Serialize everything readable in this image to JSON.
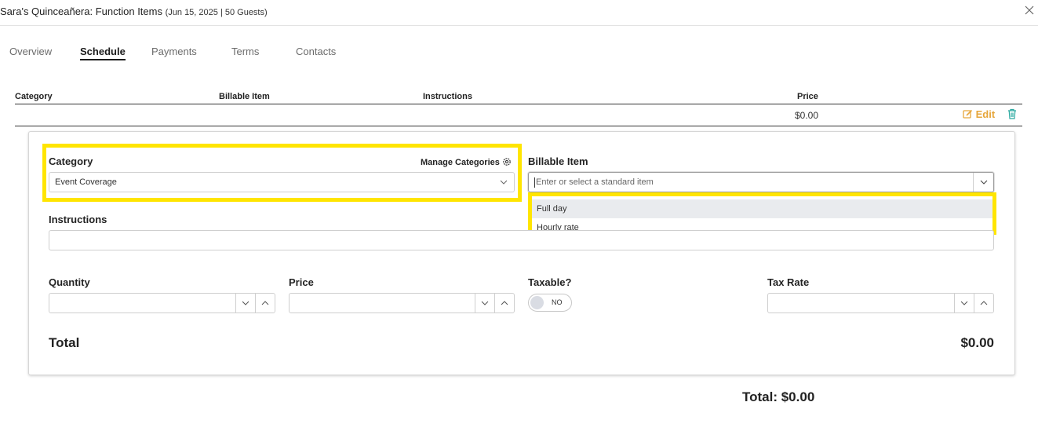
{
  "header": {
    "title": "Sara's Quinceañera: Function Items",
    "subtitle": "(Jun 15, 2025 | 50 Guests)"
  },
  "tabs": [
    {
      "label": "Overview",
      "active": false
    },
    {
      "label": "Schedule",
      "active": true
    },
    {
      "label": "Payments",
      "active": false
    },
    {
      "label": "Terms",
      "active": false
    },
    {
      "label": "Contacts",
      "active": false
    }
  ],
  "table": {
    "columns": [
      "Category",
      "Billable Item",
      "Instructions",
      "Price"
    ],
    "row": {
      "price": "$0.00",
      "edit_label": "Edit"
    }
  },
  "form": {
    "category_label": "Category",
    "manage_categories_label": "Manage Categories",
    "category_value": "Event Coverage",
    "billable_label": "Billable Item",
    "billable_placeholder": "Enter or select a standard item",
    "billable_options": [
      "Full day",
      "Hourly rate"
    ],
    "instructions_label": "Instructions",
    "quantity_label": "Quantity",
    "price_label": "Price",
    "taxable_label": "Taxable?",
    "taxable_state": "NO",
    "tax_rate_label": "Tax Rate",
    "total_label": "Total",
    "total_value": "$0.00"
  },
  "footer": {
    "grand_total": "Total: $0.00"
  },
  "colors": {
    "highlight": "#ffe500",
    "edit_accent": "#e6a63b",
    "trash_accent": "#2aa9a0"
  }
}
